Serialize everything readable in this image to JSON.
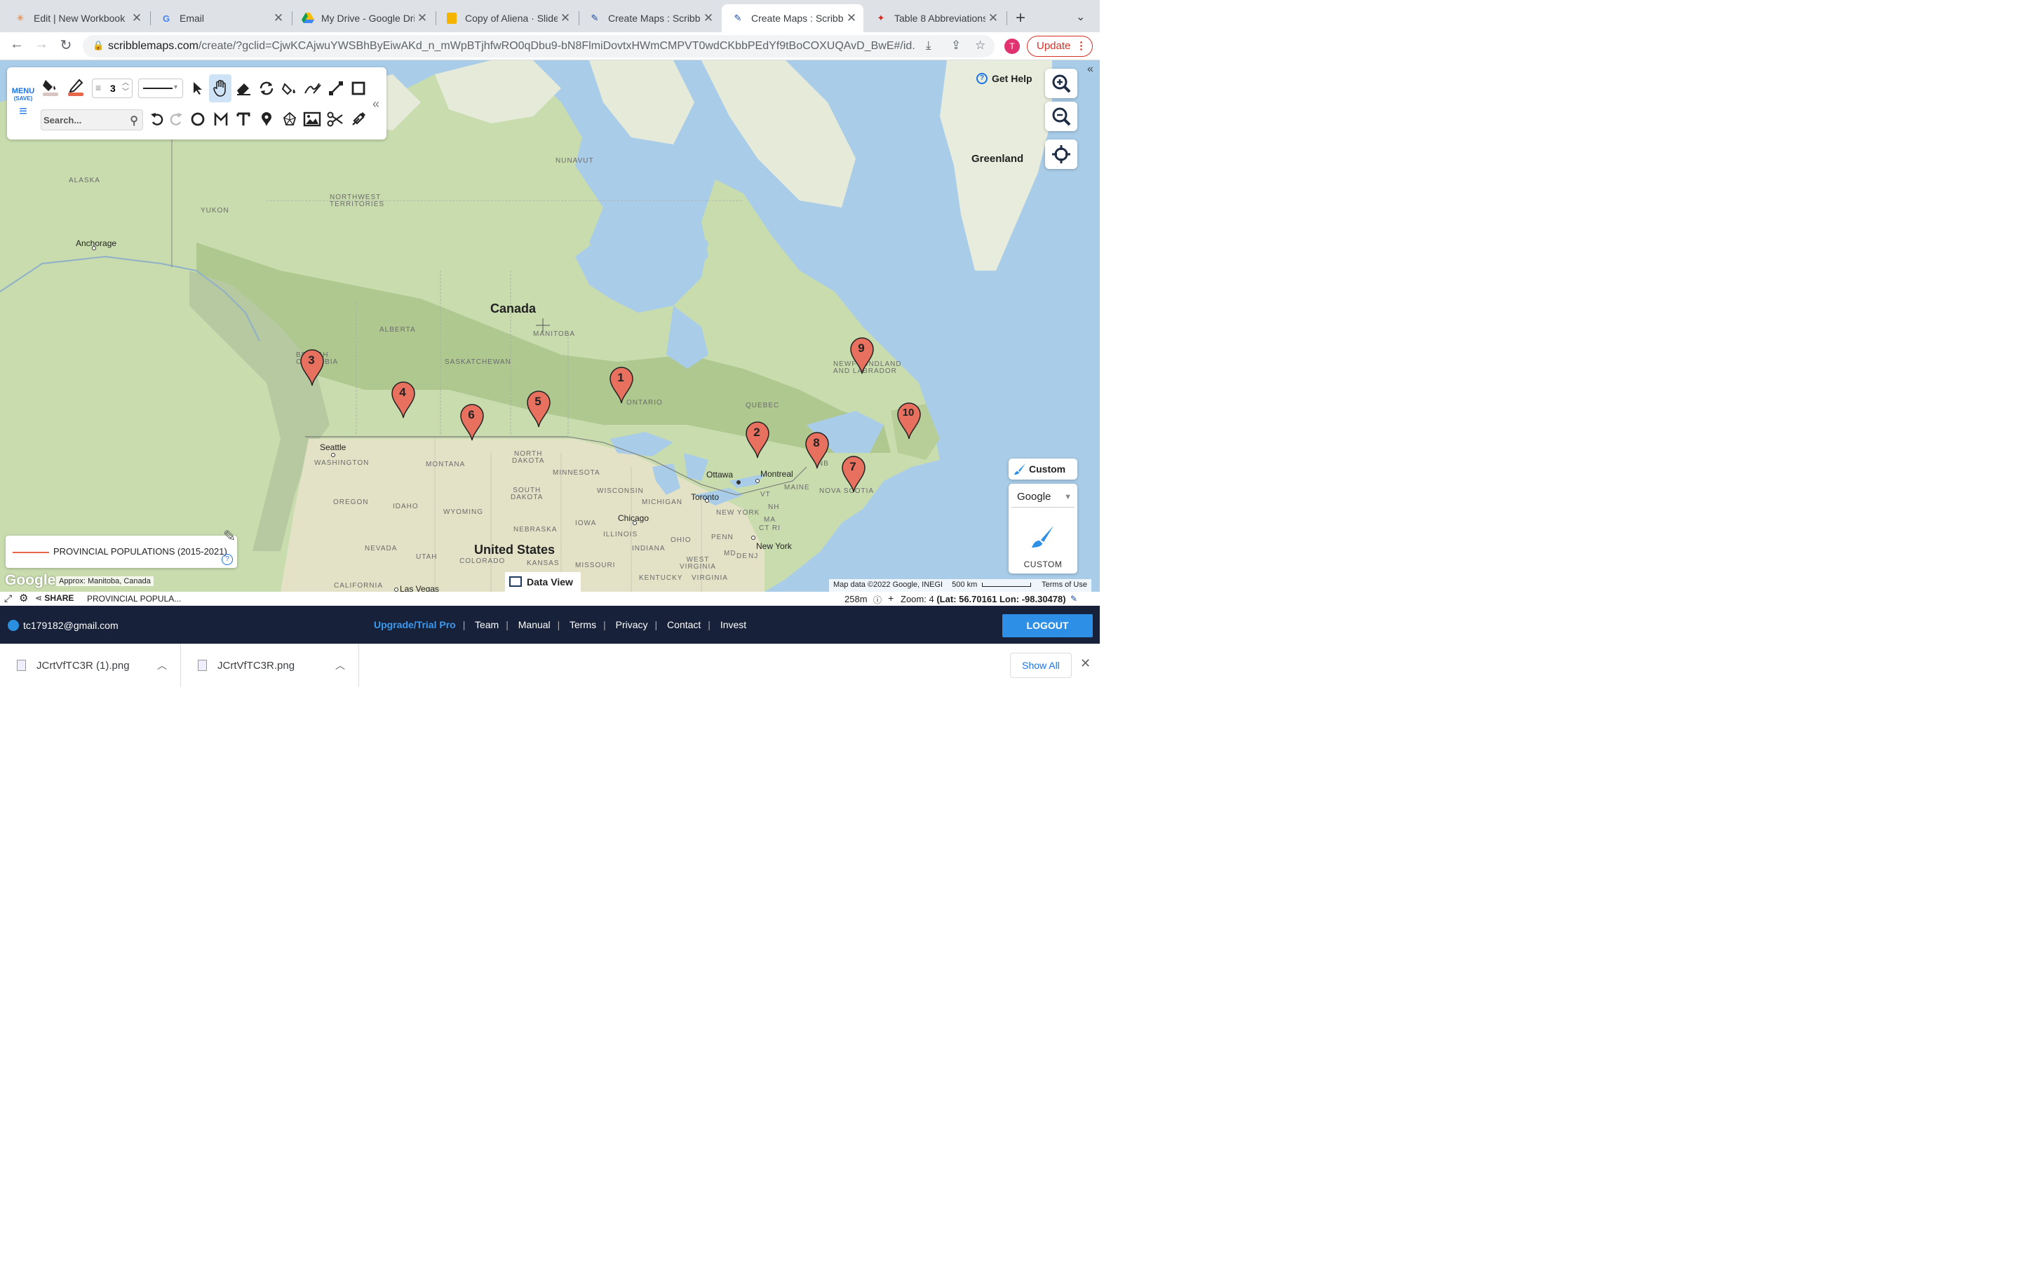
{
  "browser": {
    "tabs": [
      {
        "title": "Edit | New Workbook",
        "icon": "tableau-icon",
        "active": false
      },
      {
        "title": "Email",
        "icon": "google-icon",
        "active": false
      },
      {
        "title": "My Drive - Google Dri",
        "icon": "drive-icon",
        "active": false
      },
      {
        "title": "Copy of Aliena · Slide",
        "icon": "slides-icon",
        "active": false
      },
      {
        "title": "Create Maps : Scribbl",
        "icon": "scribblemaps-icon",
        "active": false
      },
      {
        "title": "Create Maps : Scribbl",
        "icon": "scribblemaps-icon",
        "active": true
      },
      {
        "title": "Table 8 Abbreviations",
        "icon": "maple-leaf-icon",
        "active": false
      }
    ],
    "url_domain": "scribblemaps.com",
    "url_rest": "/create/?gclid=CjwKCAjwuYWSBhByEiwAKd_n_mWpBTjhfwRO0qDbu9-bN8FlmiDovtxHWmCMPVT0wdCKbbPEdYf9tBoCOXUQAvD_BwE#/id...",
    "profile_initial": "T",
    "update_label": "Update"
  },
  "toolbar": {
    "menu_label": "MENU",
    "save_label": "(SAVE)",
    "line_weight": "3",
    "search_placeholder": "Search...",
    "accent_color": "#1a73e8",
    "pen_color": "#e8664a"
  },
  "map": {
    "get_help": "Get Help",
    "labels": {
      "canada": "Canada",
      "united_states": "United States",
      "greenland": "Greenland",
      "alaska": "ALASKA",
      "yukon": "YUKON",
      "nwt": "NORTHWEST\nTERRITORIES",
      "nunavut": "NUNAVUT",
      "alberta": "ALBERTA",
      "saskatchewan": "SASKATCHEWAN",
      "manitoba": "MANITOBA",
      "ontario": "ONTARIO",
      "quebec": "QUEBEC",
      "newfoundland": "NEWFOUNDLAND\nAND LABRADOR",
      "bc": "BRITISH\nCOLUMBIA",
      "nb": "NB",
      "nova_scotia": "NOVA SCOTIA",
      "washington": "WASHINGTON",
      "oregon": "OREGON",
      "idaho": "IDAHO",
      "montana": "MONTANA",
      "wyoming": "WYOMING",
      "nevada": "NEVADA",
      "utah": "UTAH",
      "colorado": "COLORADO",
      "california": "CALIFORNIA",
      "north_dakota": "NORTH\nDAKOTA",
      "south_dakota": "SOUTH\nDAKOTA",
      "nebraska": "NEBRASKA",
      "kansas": "KANSAS",
      "minnesota": "MINNESOTA",
      "wisconsin": "WISCONSIN",
      "iowa": "IOWA",
      "illinois": "ILLINOIS",
      "missouri": "MISSOURI",
      "michigan": "MICHIGAN",
      "indiana": "INDIANA",
      "ohio": "OHIO",
      "kentucky": "KENTUCKY",
      "virginia": "VIRGINIA",
      "west_virginia": "WEST\nVIRGINIA",
      "penn": "PENN",
      "new_york_state": "NEW YORK",
      "maine": "MAINE",
      "vt": "VT",
      "nh": "NH",
      "ma": "MA",
      "ct_ri": "CT RI",
      "nj": "NJ",
      "md": "MD",
      "de": "DE"
    },
    "cities": {
      "anchorage": "Anchorage",
      "seattle": "Seattle",
      "ottawa": "Ottawa",
      "montreal": "Montreal",
      "toronto": "Toronto",
      "chicago": "Chicago",
      "new_york": "New York",
      "las_vegas": "Las Vegas"
    },
    "markers": [
      "1",
      "2",
      "3",
      "4",
      "5",
      "6",
      "7",
      "8",
      "9",
      "10"
    ],
    "marker_color": "#e8705f",
    "custom_label": "Custom",
    "maptype_selected": "Google",
    "maptype_label": "CUSTOM",
    "legend_title": "PROVINCIAL POPULATIONS (2015-2021)",
    "google_logo": "Google",
    "approx": "Approx: Manitoba, Canada",
    "data_view": "Data View",
    "attribution": "Map data ©2022 Google, INEGI",
    "scale": "500 km",
    "terms": "Terms of Use"
  },
  "status": {
    "share": "SHARE",
    "map_name": "PROVINCIAL POPULA...",
    "altitude": "258m",
    "zoom": "Zoom: 4",
    "lat": "(Lat: 56.70161",
    "lon": "Lon: -98.30478)"
  },
  "footer": {
    "email": "tc179182@gmail.com",
    "links": [
      "Upgrade/Trial Pro",
      "Team",
      "Manual",
      "Terms",
      "Privacy",
      "Contact",
      "Invest"
    ],
    "logout": "LOGOUT"
  },
  "downloads": {
    "items": [
      "JCrtVfTC3R (1).png",
      "JCrtVfTC3R.png"
    ],
    "show_all": "Show All"
  }
}
